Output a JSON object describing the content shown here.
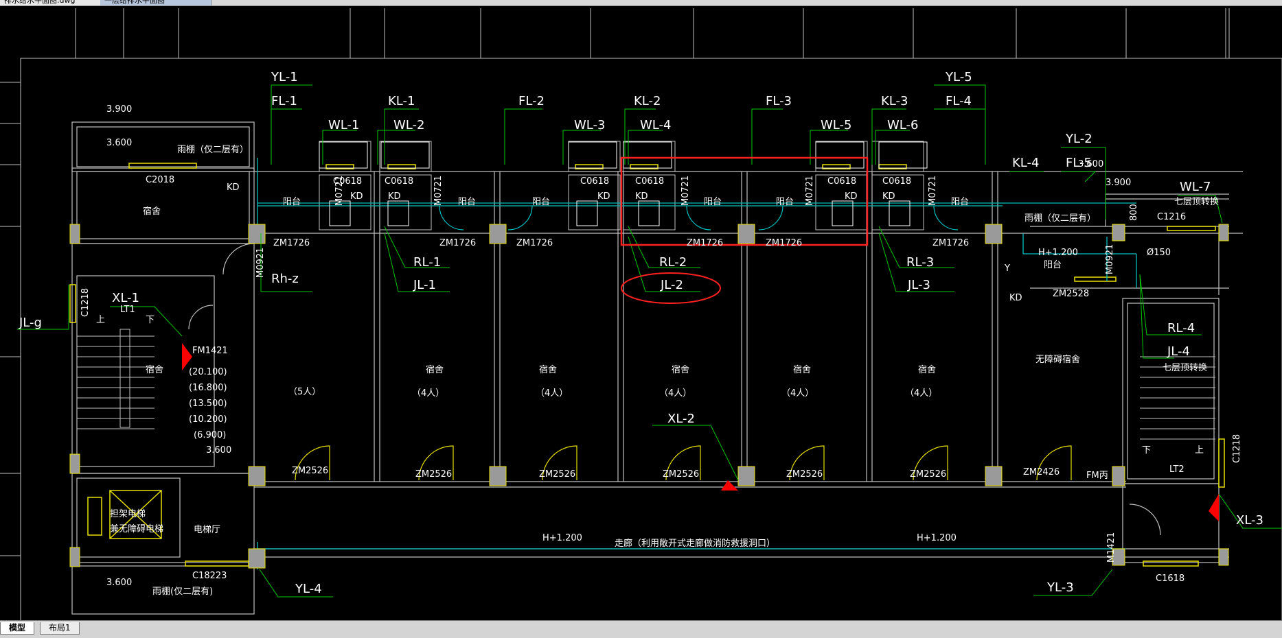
{
  "window": {
    "doc_tab_1": "排水给水平面图.dwg",
    "doc_tab_2": "一层给排水平面图"
  },
  "layout_tabs": [
    "模型",
    "布局1"
  ],
  "labels": {
    "yl1": "YL-1",
    "fl1": "FL-1",
    "kl1": "KL-1",
    "fl2": "FL-2",
    "kl2": "KL-2",
    "fl3": "FL-3",
    "kl3": "KL-3",
    "fl4": "FL-4",
    "yl5": "YL-5",
    "wl1": "WL-1",
    "wl2": "WL-2",
    "wl3": "WL-3",
    "wl4": "WL-4",
    "wl5": "WL-5",
    "wl6": "WL-6",
    "yl2": "YL-2",
    "kl4": "KL-4",
    "fl5": "FL-5",
    "wl7": "WL-7",
    "wl7_note": "七层顶转换",
    "rl1": "RL-1",
    "jl1": "JL-1",
    "rl2": "RL-2",
    "jl2": "JL-2",
    "rl3": "RL-3",
    "jl3": "JL-3",
    "rl4": "RL-4",
    "jl4": "JL-4",
    "rl4_note": "七层顶转换",
    "rhz": "Rh-z",
    "jlg": "JL-g",
    "xl1": "XL-1",
    "xl2": "XL-2",
    "xl3": "XL-3",
    "yl3": "YL-3",
    "yl4": "YL-4"
  },
  "annotations": {
    "elev_3900": "3.900",
    "elev_3600": "3.600",
    "elev_3600b": "3.600",
    "elev_3600c": "3.600",
    "elev_3900r": "3.900",
    "elev_3600r": "3.600",
    "canopy": "雨棚（仅二层有）",
    "canopy_r": "雨棚（仅二层有）",
    "canopy_b": "雨棚(仅二层有)",
    "c2018": "C2018",
    "dorm": "宿舍",
    "c1218": "C1218",
    "c1218r": "C1218",
    "lt1": "LT1",
    "lt2": "LT2",
    "up": "上",
    "down": "下",
    "up_r": "上",
    "down_r": "下",
    "fm1421": "FM1421",
    "elevs": [
      "(20.100)",
      "(16.800)",
      "(13.500)",
      "(10.200)",
      "(6.900)"
    ],
    "m0921": "M0921",
    "elevator_room": "电梯厅",
    "elevator_1": "担架电梯",
    "elevator_2": "兼无障碍电梯",
    "c18223": "C18223",
    "rooms": [
      "宿舍",
      "宿舍",
      "宿舍",
      "宿舍",
      "宿舍",
      "宿舍",
      "无障碍宿舍"
    ],
    "occupancy": [
      "（5人）",
      "（4人）",
      "（4人）",
      "（4人）",
      "（4人）",
      "（4人）"
    ],
    "zm_top": [
      "ZM1726",
      "ZM1726",
      "ZM1726",
      "ZM1726",
      "ZM1726",
      "ZM1726",
      "ZM2528"
    ],
    "zm_bot": [
      "ZM2526",
      "ZM2526",
      "ZM2526",
      "ZM2526",
      "ZM2526",
      "ZM2526",
      "ZM2426"
    ],
    "balcony": "阳台",
    "c0618": "C0618",
    "m0721": "M0721",
    "kd": "KD",
    "h1200": "H+1.200",
    "corridor": "走廊（利用敞开式走廊做消防救援洞口）",
    "c1216": "C1216",
    "c1618": "C1618",
    "m1421": "M1421",
    "d800": "800",
    "d150": "Ø150",
    "fm": "FM丙",
    "y": "Y"
  },
  "colors": {
    "wall": "#c0c0c0",
    "window": "#e8e000",
    "pipe": "#00c0c0",
    "leader": "#00c800",
    "text": "#ffffff",
    "highlight": "#ff2020",
    "column": "#a0a0a0",
    "fire": "#ff0000"
  }
}
